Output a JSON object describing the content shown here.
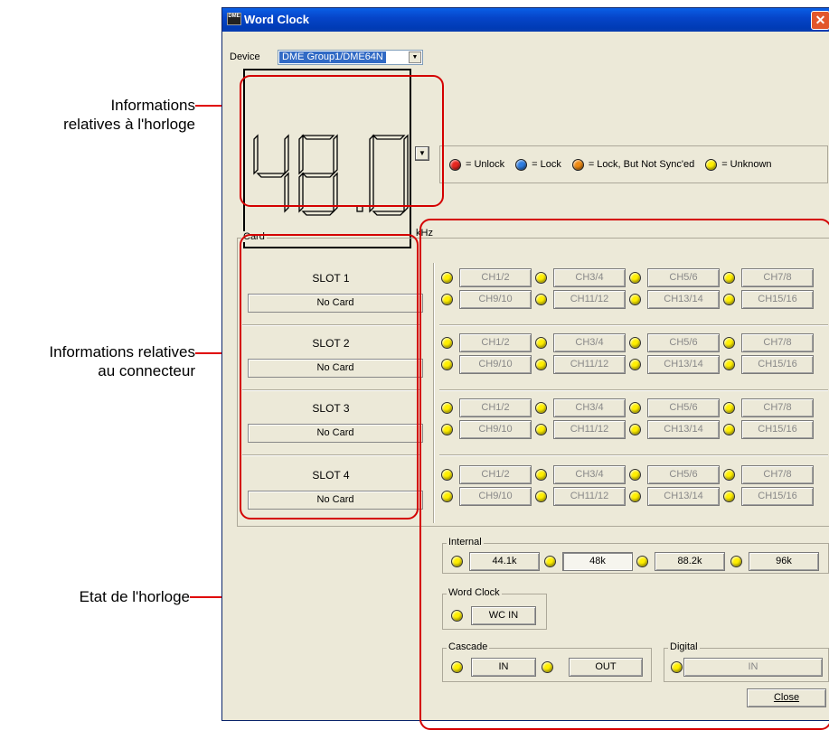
{
  "annotations": {
    "clock_info": "Informations\nrelatives à l'horloge",
    "connector_info": "Informations relatives\nau connecteur",
    "clock_status": "Etat de l'horloge"
  },
  "window": {
    "title": "Word Clock",
    "close_glyph": "✕",
    "icon_text": "DME"
  },
  "device": {
    "label": "Device",
    "value": "DME Group1/DME64N"
  },
  "lcd": {
    "value": "48.0",
    "unit": "kHz"
  },
  "legend": [
    {
      "label": "= Unlock",
      "color": "#e8261f"
    },
    {
      "label": "= Lock",
      "color": "#2f7de1"
    },
    {
      "label": "= Lock, But Not Sync'ed",
      "color": "#f08a12"
    },
    {
      "label": "= Unknown",
      "color": "#ffef00"
    }
  ],
  "card": {
    "title": "Card",
    "slots": [
      {
        "name": "SLOT 1",
        "status": "No Card"
      },
      {
        "name": "SLOT 2",
        "status": "No Card"
      },
      {
        "name": "SLOT 3",
        "status": "No Card"
      },
      {
        "name": "SLOT 4",
        "status": "No Card"
      }
    ],
    "channels": [
      "CH1/2",
      "CH3/4",
      "CH5/6",
      "CH7/8",
      "CH9/10",
      "CH11/12",
      "CH13/14",
      "CH15/16"
    ]
  },
  "internal": {
    "title": "Internal",
    "rates": [
      "44.1k",
      "48k",
      "88.2k",
      "96k"
    ]
  },
  "word_clock": {
    "title": "Word Clock",
    "button": "WC IN"
  },
  "cascade": {
    "title": "Cascade",
    "in": "IN",
    "out": "OUT"
  },
  "digital": {
    "title": "Digital",
    "in": "IN"
  },
  "close_button": "Close"
}
